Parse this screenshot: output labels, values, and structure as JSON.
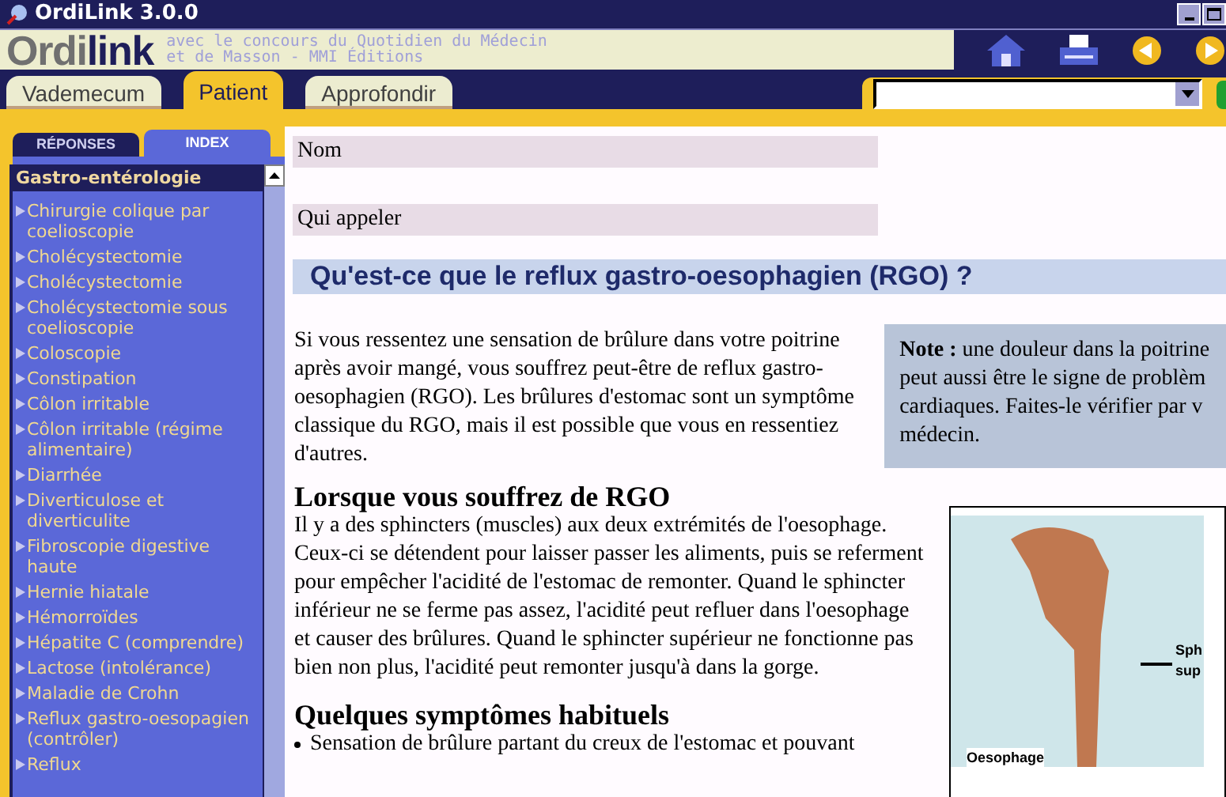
{
  "window": {
    "title": "OrdiLink 3.0.0"
  },
  "banner": {
    "logo_part_1": "Ordi",
    "logo_part_2": "link",
    "subtitle_lines": [
      "avec le concours du Quotidien du Médecin",
      "et de Masson - MMI Éditions"
    ]
  },
  "tabs": [
    {
      "label": "Vademecum",
      "selected": false
    },
    {
      "label": "Patient",
      "selected": true
    },
    {
      "label": "Approfondir",
      "selected": false
    }
  ],
  "subtabs": [
    {
      "label": "RÉPONSES",
      "selected": false
    },
    {
      "label": "INDEX",
      "selected": true
    }
  ],
  "sidebar": {
    "header": "Gastro-entérologie",
    "items": [
      {
        "label": "Chirurgie colique par coelioscopie"
      },
      {
        "label": "Cholécystectomie"
      },
      {
        "label": "Cholécystectomie"
      },
      {
        "label": "Cholécystectomie sous coelioscopie"
      },
      {
        "label": "Coloscopie"
      },
      {
        "label": "Constipation"
      },
      {
        "label": "Côlon irritable"
      },
      {
        "label": "Côlon irritable (régime alimentaire)"
      },
      {
        "label": "Diarrhée"
      },
      {
        "label": "Diverticulose et diverticulite"
      },
      {
        "label": "Fibroscopie digestive haute"
      },
      {
        "label": "Hernie hiatale"
      },
      {
        "label": "Hémorroïdes"
      },
      {
        "label": "Hépatite C (comprendre)"
      },
      {
        "label": "Lactose (intolérance)"
      },
      {
        "label": "Maladie de Crohn"
      },
      {
        "label": "Reflux gastro-oesopagien (contrôler)"
      },
      {
        "label": "Reflux"
      }
    ]
  },
  "fields": [
    {
      "label": "Nom"
    },
    {
      "label": "Qui appeler"
    }
  ],
  "article": {
    "title": "Qu'est-ce que le reflux gastro-oesophagien (RGO) ?",
    "intro": "Si vous ressentez une sensation de brûlure dans votre poitrine après avoir mangé, vous souffrez peut-être de reflux gastro-oesophagien (RGO). Les brûlures d'estomac sont un symptôme classique du RGO, mais il est possible que vous en ressentiez d'autres.",
    "note_lines": [
      "**Note :** une douleur dans la poitrine",
      "peut aussi être le signe de problèm",
      "cardiaques. Faites-le vérifier par v",
      "médecin."
    ],
    "sections": [
      {
        "heading": "Lorsque vous souffrez de RGO",
        "text": "Il y a des sphincters (muscles) aux deux extrémités de l'oesophage. Ceux-ci se détendent pour laisser passer les aliments, puis se referment pour empêcher l'acidité de l'estomac de remonter. Quand le sphincter inférieur ne se ferme pas assez, l'acidité peut refluer dans l'oesophage et causer des brûlures. Quand le sphincter supérieur ne fonctionne pas bien non plus, l'acidité peut remonter jusqu'à dans la gorge."
      },
      {
        "heading": "Quelques symptômes habituels",
        "bullets": [
          "Sensation de brûlure partant du creux de l'estomac et pouvant"
        ]
      }
    ],
    "figure_labels": [
      "Sph",
      "sup",
      "Oesophage"
    ]
  }
}
